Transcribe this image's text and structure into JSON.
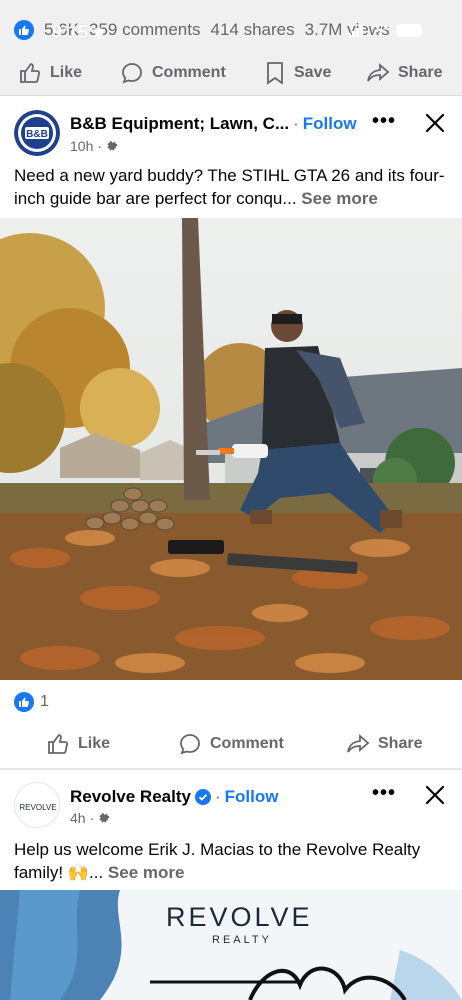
{
  "stats": {
    "likes": "5.6K",
    "comments": "359 comments",
    "shares": "414 shares",
    "views": "3.7M views"
  },
  "status_bar": {
    "time": "9:15"
  },
  "action_bar_top": {
    "like": "Like",
    "comment": "Comment",
    "save": "Save",
    "share": "Share"
  },
  "post1": {
    "page_name": "B&B Equipment; Lawn, C...",
    "separator": "·",
    "follow": "Follow",
    "time": "10h",
    "text": "Need a new yard buddy? The STIHL GTA 26 and its four-inch guide bar are perfect for conqu...",
    "see_more": "See more",
    "avatar_text_top": "B&B",
    "reaction_count": "1",
    "actions": {
      "like": "Like",
      "comment": "Comment",
      "share": "Share"
    }
  },
  "post2": {
    "page_name": "Revolve Realty",
    "separator": "·",
    "follow": "Follow",
    "time": "4h",
    "text": "Help us welcome Erik J. Macias to the Revolve Realty family! 🙌...",
    "see_more": "See more",
    "avatar_text": "REVOLVE",
    "image_logo": "REVOLVE",
    "image_logo_sub": "REALTY"
  },
  "colors": {
    "accent": "#1877f2",
    "muted": "#65676b",
    "bar_bg": "#f0f0f0"
  }
}
